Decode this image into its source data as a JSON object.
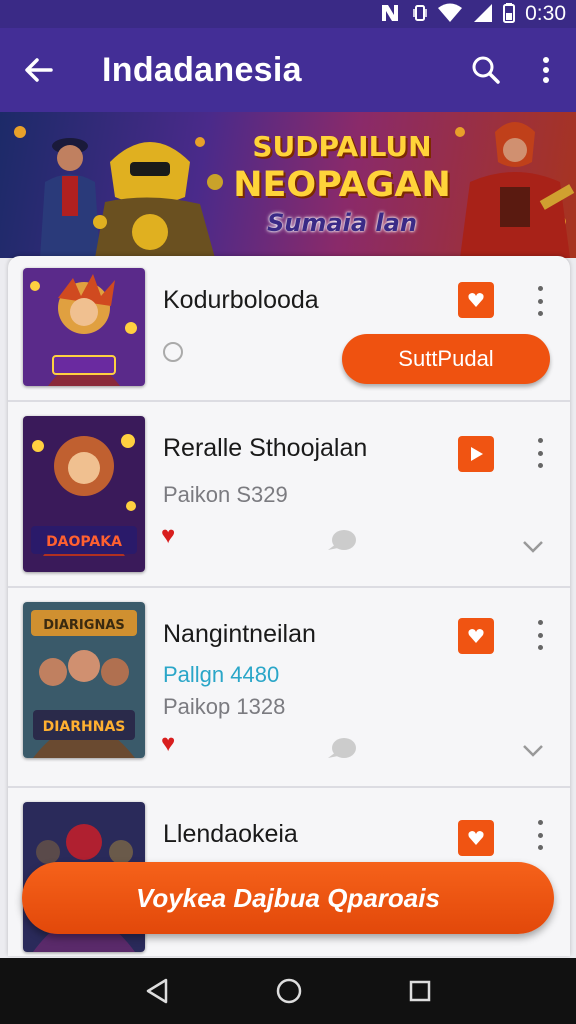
{
  "status_bar": {
    "time": "0:30",
    "icons": [
      "nfc-icon",
      "vibrate-icon",
      "wifi-icon",
      "signal-icon",
      "battery-icon"
    ]
  },
  "app_bar": {
    "title": "Indadanesia",
    "icons": [
      "back-arrow-icon",
      "search-icon",
      "more-vert-icon"
    ]
  },
  "banner": {
    "line1": "SUDPAILUN",
    "line2": "NEOPAGAN",
    "line3": "Sumaia lan"
  },
  "list": [
    {
      "title": "Kodurbolooda",
      "button_label": "SuttPudal"
    },
    {
      "title": "Reralle Sthoojalan",
      "subtitle": "Paikon S329"
    },
    {
      "title": "Nangintneilan",
      "subtitle_accent": "Pallgn 4480",
      "subtitle": "Paikop 1328"
    },
    {
      "title": "Llendaokeia"
    }
  ],
  "primary_button": {
    "label": "Voykea Dajbua Qparoais"
  },
  "colors": {
    "app_bar": "#432e96",
    "status_bar": "#3a2a86",
    "accent": "#f05412",
    "heart": "#d81e1e",
    "teal_text": "#2aa6c8"
  }
}
